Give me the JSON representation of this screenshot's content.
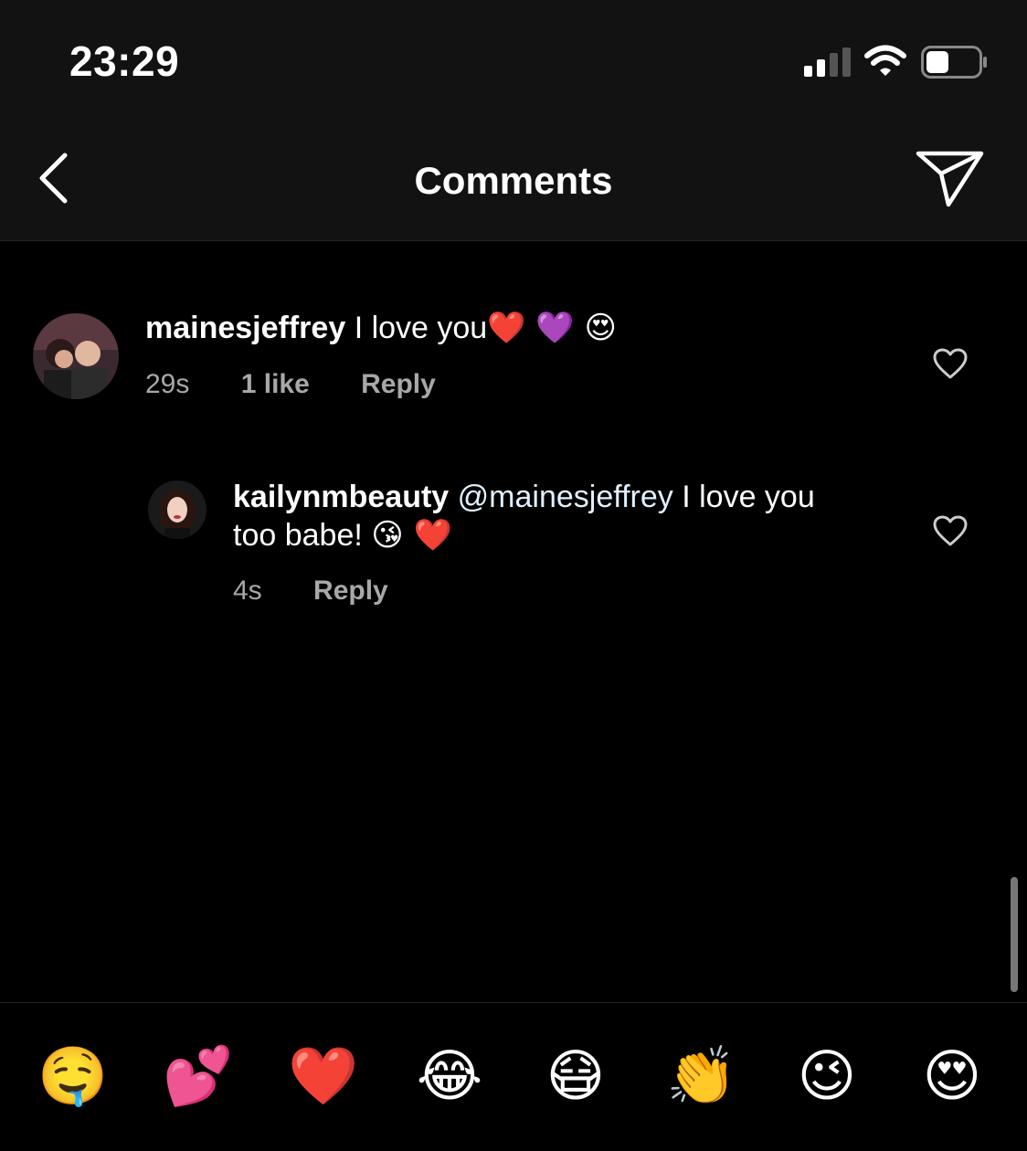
{
  "status_bar": {
    "time": "23:29"
  },
  "nav": {
    "title": "Comments"
  },
  "comments": [
    {
      "username": "mainesjeffrey",
      "text": "I love you",
      "emojis": "❤️ 💜 😍",
      "time": "29s",
      "likes": "1 like",
      "reply_label": "Reply"
    },
    {
      "username": "kailynmbeauty",
      "mention": "@mainesjeffrey",
      "text_line1": "I love you",
      "text_line2": "too babe!",
      "emojis": "😘 ❤️",
      "time": "4s",
      "reply_label": "Reply"
    }
  ],
  "emoji_bar": [
    "🤤",
    "💕",
    "❤️",
    "😂",
    "😷",
    "👏",
    "😉",
    "😍"
  ]
}
